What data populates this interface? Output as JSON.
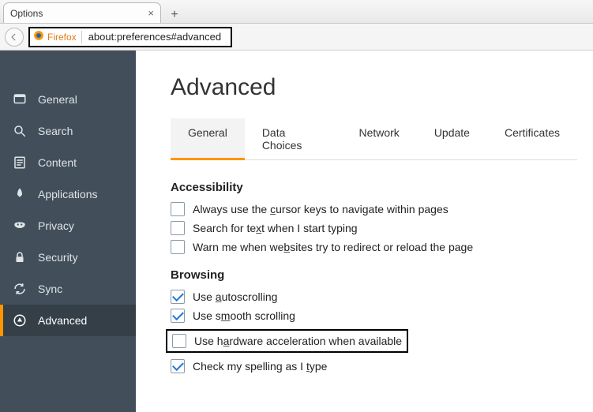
{
  "window": {
    "tab_title": "Options"
  },
  "urlbar": {
    "brand": "Firefox",
    "url": "about:preferences#advanced"
  },
  "sidebar": {
    "items": [
      {
        "label": "General"
      },
      {
        "label": "Search"
      },
      {
        "label": "Content"
      },
      {
        "label": "Applications"
      },
      {
        "label": "Privacy"
      },
      {
        "label": "Security"
      },
      {
        "label": "Sync"
      },
      {
        "label": "Advanced"
      }
    ]
  },
  "page": {
    "title": "Advanced"
  },
  "subtabs": [
    {
      "label": "General"
    },
    {
      "label": "Data Choices"
    },
    {
      "label": "Network"
    },
    {
      "label": "Update"
    },
    {
      "label": "Certificates"
    }
  ],
  "sections": {
    "accessibility": {
      "heading": "Accessibility",
      "opts": [
        {
          "label_pre": "Always use the ",
          "accel": "c",
          "label_post": "ursor keys to navigate within pages",
          "checked": false
        },
        {
          "label_pre": "Search for te",
          "accel": "x",
          "label_post": "t when I start typing",
          "checked": false
        },
        {
          "label_pre": "Warn me when we",
          "accel": "b",
          "label_post": "sites try to redirect or reload the page",
          "checked": false
        }
      ]
    },
    "browsing": {
      "heading": "Browsing",
      "opts": [
        {
          "label_pre": "Use ",
          "accel": "a",
          "label_post": "utoscrolling",
          "checked": true
        },
        {
          "label_pre": "Use s",
          "accel": "m",
          "label_post": "ooth scrolling",
          "checked": true
        },
        {
          "label_pre": "Use h",
          "accel": "a",
          "label_post": "rdware acceleration when available",
          "checked": false,
          "highlight": true
        },
        {
          "label_pre": "Check my spelling as I ",
          "accel": "t",
          "label_post": "ype",
          "checked": true
        }
      ]
    }
  }
}
